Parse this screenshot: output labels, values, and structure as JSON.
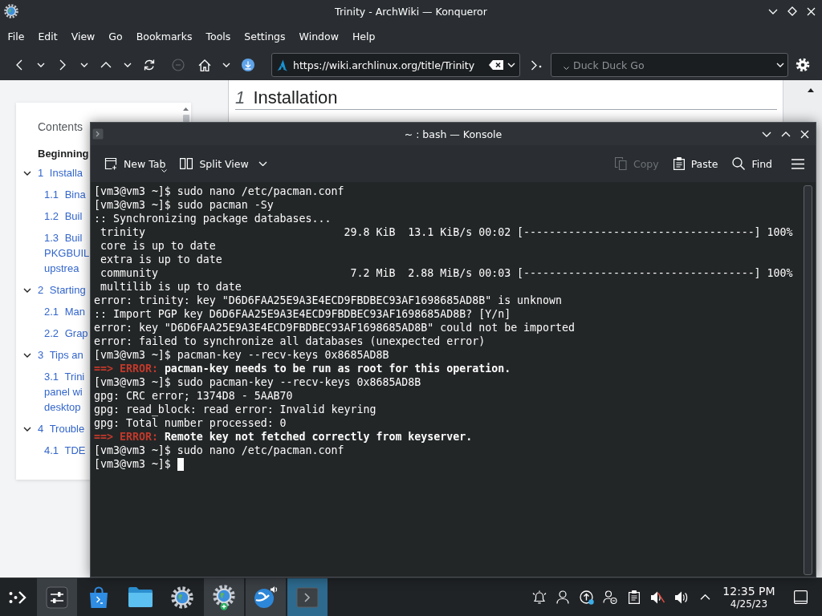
{
  "konqueror": {
    "title": "Trinity - ArchWiki — Konqueror",
    "menu": [
      "File",
      "Edit",
      "View",
      "Go",
      "Bookmarks",
      "Tools",
      "Settings",
      "Window",
      "Help"
    ],
    "stop_button": {
      "disabled": true
    },
    "url": "https://wiki.archlinux.org/title/Trinity",
    "search": {
      "placeholder": "Duck Duck Go"
    }
  },
  "page": {
    "toc": {
      "title": "Contents",
      "top_link": "Beginning",
      "items": [
        {
          "number": "1",
          "lines": [
            "Installa"
          ],
          "expanded": true,
          "children": [
            {
              "number": "1.1",
              "lines": [
                "Bina"
              ]
            },
            {
              "number": "1.2",
              "lines": [
                "Buil"
              ]
            },
            {
              "number": "1.3",
              "lines": [
                "Buil",
                "PKGBUIL",
                "upstrea"
              ]
            }
          ]
        },
        {
          "number": "2",
          "lines": [
            "Starting"
          ],
          "expanded": true,
          "children": [
            {
              "number": "2.1",
              "lines": [
                "Man"
              ]
            },
            {
              "number": "2.2",
              "lines": [
                "Grap"
              ]
            }
          ]
        },
        {
          "number": "3",
          "lines": [
            "Tips an"
          ],
          "expanded": true,
          "children": [
            {
              "number": "3.1",
              "lines": [
                "Trini",
                "panel wi",
                "desktop"
              ]
            }
          ]
        },
        {
          "number": "4",
          "lines": [
            "Trouble"
          ],
          "expanded": true,
          "children": [
            {
              "number": "4.1",
              "lines": [
                "TDE"
              ]
            }
          ]
        }
      ]
    },
    "heading": {
      "number": "1",
      "title": "Installation"
    }
  },
  "konsole": {
    "title": "~ : bash — Konsole",
    "toolbar_left": [
      "New Tab",
      "Split View"
    ],
    "toolbar_right": [
      {
        "label": "Copy",
        "disabled": true
      },
      {
        "label": "Paste",
        "disabled": false
      },
      {
        "label": "Find",
        "disabled": false
      }
    ],
    "lines": [
      {
        "kind": "text",
        "text": "[vm3@vm3 ~]$ sudo nano /etc/pacman.conf"
      },
      {
        "kind": "text",
        "text": "[vm3@vm3 ~]$ sudo pacman -Sy"
      },
      {
        "kind": "text",
        "text": ":: Synchronizing package databases..."
      },
      {
        "kind": "text",
        "text": " trinity                               29.8 KiB  13.1 KiB/s 00:02 [------------------------------------] 100%"
      },
      {
        "kind": "text",
        "text": " core is up to date"
      },
      {
        "kind": "text",
        "text": " extra is up to date"
      },
      {
        "kind": "text",
        "text": " community                              7.2 MiB  2.88 MiB/s 00:03 [------------------------------------] 100%"
      },
      {
        "kind": "text",
        "text": " multilib is up to date"
      },
      {
        "kind": "text",
        "text": "error: trinity: key \"D6D6FAA25E9A3E4ECD9FBDBEC93AF1698685AD8B\" is unknown"
      },
      {
        "kind": "text",
        "text": ":: Import PGP key D6D6FAA25E9A3E4ECD9FBDBEC93AF1698685AD8B? [Y/n]"
      },
      {
        "kind": "text",
        "text": "error: key \"D6D6FAA25E9A3E4ECD9FBDBEC93AF1698685AD8B\" could not be imported"
      },
      {
        "kind": "text",
        "text": "error: failed to synchronize all databases (unexpected error)"
      },
      {
        "kind": "text",
        "text": "[vm3@vm3 ~]$ pacman-key --recv-keys 0x8685AD8B"
      },
      {
        "kind": "error",
        "label": "==> ERROR:",
        "text": "pacman-key needs to be run as root for this operation."
      },
      {
        "kind": "text",
        "text": "[vm3@vm3 ~]$ sudo pacman-key --recv-keys 0x8685AD8B"
      },
      {
        "kind": "text",
        "text": "gpg: CRC error; 1374D8 - 5AAB70"
      },
      {
        "kind": "text",
        "text": "gpg: read_block: read error: Invalid keyring"
      },
      {
        "kind": "text",
        "text": "gpg: Total number processed: 0"
      },
      {
        "kind": "error",
        "label": "==> ERROR:",
        "text": "Remote key not fetched correctly from keyserver."
      },
      {
        "kind": "text",
        "text": "[vm3@vm3 ~]$ sudo nano /etc/pacman.conf"
      },
      {
        "kind": "prompt",
        "text": "[vm3@vm3 ~]$",
        "cursor": true
      }
    ]
  },
  "taskbar": {
    "tasks": [
      {
        "running": true,
        "selected": false
      },
      {
        "running": false,
        "selected": false
      },
      {
        "running": false,
        "selected": false
      },
      {
        "running": false,
        "selected": false
      },
      {
        "running": true,
        "selected": false
      },
      {
        "running": true,
        "selected": false
      },
      {
        "running": true,
        "selected": true
      }
    ],
    "clock": {
      "time": "12:35 PM",
      "date": "4/25/23"
    }
  }
}
